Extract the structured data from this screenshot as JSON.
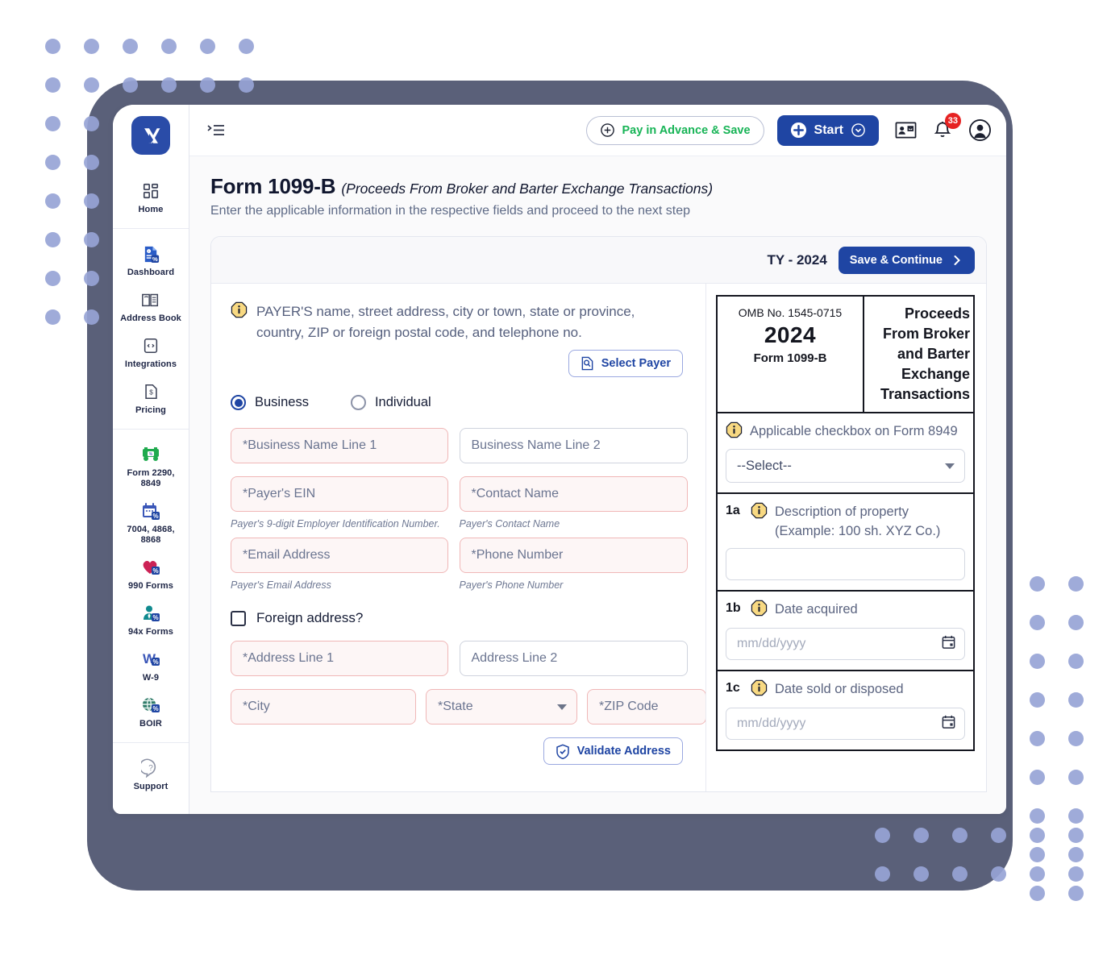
{
  "brand": {
    "logo_alt": "x-logo",
    "accent": "#1f45a3",
    "accent_green": "#17b456",
    "badge_red": "#e62222",
    "dot_color": "#97a4d6",
    "frame_color": "#5a6079"
  },
  "topbar": {
    "menu_icon": "collapse-menu-icon",
    "pay_button": "Pay in Advance & Save",
    "start_button": "Start",
    "contacts_icon": "contact-card-icon",
    "bell_icon": "notification-bell-icon",
    "notification_count": "33",
    "account_icon": "user-account-icon"
  },
  "sidebar": {
    "groups": [
      {
        "items": [
          {
            "label": "Home",
            "icon": "home-grid-icon"
          }
        ]
      },
      {
        "items": [
          {
            "label": "Dashboard",
            "icon": "dashboard-doc-icon"
          },
          {
            "label": "Address Book",
            "icon": "address-book-icon"
          },
          {
            "label": "Integrations",
            "icon": "integrations-code-icon"
          },
          {
            "label": "Pricing",
            "icon": "pricing-dollar-icon"
          }
        ]
      },
      {
        "items": [
          {
            "label": "Form 2290, 8849",
            "icon": "truck-icon"
          },
          {
            "label": "7004, 4868, 8868",
            "icon": "calendar-icon"
          },
          {
            "label": "990 Forms",
            "icon": "heart-icon"
          },
          {
            "label": "94x Forms",
            "icon": "person-tie-icon"
          },
          {
            "label": "W-9",
            "icon": "w9-icon"
          },
          {
            "label": "BOIR",
            "icon": "globe-icon"
          }
        ]
      },
      {
        "items": [
          {
            "label": "Support",
            "icon": "help-question-icon"
          }
        ]
      }
    ]
  },
  "page": {
    "title": "Form 1099-B",
    "title_sub": "(Proceeds From Broker and Barter Exchange Transactions)",
    "description": "Enter the applicable information in the respective fields and proceed to the next step"
  },
  "card_header": {
    "tax_year": "TY - 2024",
    "save_button": "Save & Continue"
  },
  "payer": {
    "info_icon": "info-icon",
    "instruction": "PAYER'S name, street address, city or town, state or province, country, ZIP or foreign postal code, and telephone no.",
    "select_payer_button": "Select Payer",
    "select_payer_icon": "document-search-icon",
    "entity_type": {
      "selected": "Business",
      "options": [
        "Business",
        "Individual"
      ]
    },
    "fields": {
      "business_name_1": {
        "placeholder": "*Business Name Line 1",
        "value": "",
        "required": true
      },
      "business_name_2": {
        "placeholder": "Business Name Line 2",
        "value": "",
        "required": false
      },
      "ein": {
        "placeholder": "*Payer's EIN",
        "value": "",
        "required": true,
        "hint": "Payer's 9-digit Employer Identification Number."
      },
      "contact_name": {
        "placeholder": "*Contact Name",
        "value": "",
        "required": true,
        "hint": "Payer's Contact Name"
      },
      "email": {
        "placeholder": "*Email Address",
        "value": "",
        "required": true,
        "hint": "Payer's Email Address"
      },
      "phone": {
        "placeholder": "*Phone Number",
        "value": "",
        "required": true,
        "hint": "Payer's Phone Number"
      },
      "foreign_address_label": "Foreign address?",
      "foreign_address_checked": false,
      "address_1": {
        "placeholder": "*Address Line 1",
        "value": "",
        "required": true
      },
      "address_2": {
        "placeholder": "Address Line 2",
        "value": "",
        "required": false
      },
      "city": {
        "placeholder": "*City",
        "value": "",
        "required": true
      },
      "state": {
        "placeholder": "*State",
        "value": "",
        "required": true
      },
      "zip": {
        "placeholder": "*ZIP Code",
        "value": "",
        "required": true
      }
    },
    "validate_button": "Validate Address",
    "validate_icon": "shield-check-icon"
  },
  "preview": {
    "omb_number": "OMB No. 1545-0715",
    "year": "2024",
    "form_name": "Form 1099-B",
    "form_title": "Proceeds From Broker and Barter Exchange Transactions",
    "blocks": [
      {
        "num": "",
        "info_icon": "info-icon",
        "label": "Applicable checkbox on Form 8949",
        "control": "select",
        "value": "--Select--"
      },
      {
        "num": "1a",
        "info_icon": "info-icon",
        "label": "Description of property (Example: 100 sh. XYZ Co.)",
        "control": "text",
        "placeholder": ""
      },
      {
        "num": "1b",
        "info_icon": "info-icon",
        "label": "Date acquired",
        "control": "date",
        "placeholder": "mm/dd/yyyy",
        "icon": "calendar-icon"
      },
      {
        "num": "1c",
        "info_icon": "info-icon",
        "label": "Date sold or disposed",
        "control": "date",
        "placeholder": "mm/dd/yyyy",
        "icon": "calendar-icon"
      }
    ]
  }
}
